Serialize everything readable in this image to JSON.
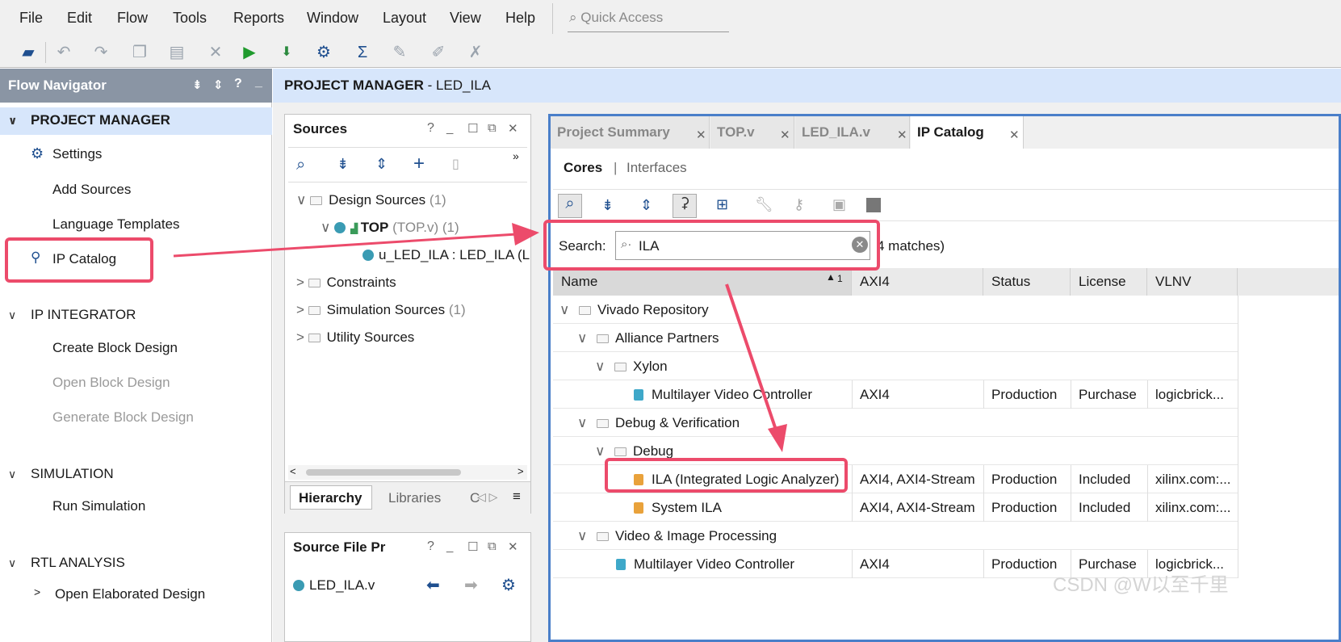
{
  "menu": {
    "file": "File",
    "edit": "Edit",
    "flow": "Flow",
    "tools": "Tools",
    "reports": "Reports",
    "window": "Window",
    "layout": "Layout",
    "view": "View",
    "help": "Help",
    "quick_access": "Quick Access"
  },
  "flow_nav": {
    "title": "Flow Navigator",
    "project_manager": "PROJECT MANAGER",
    "settings": "Settings",
    "add_sources": "Add Sources",
    "language_templates": "Language Templates",
    "ip_catalog": "IP Catalog",
    "ip_integrator": "IP INTEGRATOR",
    "create_block_design": "Create Block Design",
    "open_block_design": "Open Block Design",
    "generate_block_design": "Generate Block Design",
    "simulation": "SIMULATION",
    "run_simulation": "Run Simulation",
    "rtl_analysis": "RTL ANALYSIS",
    "open_elaborated_design": "Open Elaborated Design"
  },
  "header": {
    "title": "PROJECT MANAGER",
    "project": " - LED_ILA"
  },
  "sources": {
    "title": "Sources",
    "design_sources": "Design Sources",
    "design_sources_count": "(1)",
    "top": "TOP",
    "top_file": "(TOP.v) (1)",
    "u_led_ila": "u_LED_ILA : LED_ILA (L",
    "constraints": "Constraints",
    "simulation_sources": "Simulation Sources",
    "simulation_sources_count": "(1)",
    "utility_sources": "Utility Sources",
    "tab_hierarchy": "Hierarchy",
    "tab_libraries": "Libraries",
    "tab_c": "C"
  },
  "source_file_props": {
    "title": "Source File Pr",
    "file": "LED_ILA.v"
  },
  "tabs": {
    "project_summary": "Project Summary",
    "top_v": "TOP.v",
    "led_ila_v": "LED_ILA.v",
    "ip_catalog": "IP Catalog"
  },
  "ip_catalog": {
    "cores": "Cores",
    "divider": "|",
    "interfaces": "Interfaces",
    "search_label": "Search:",
    "search_value": "ILA",
    "matches": "4 matches)",
    "columns": {
      "name": "Name",
      "sort": "1",
      "axi4": "AXI4",
      "status": "Status",
      "license": "License",
      "vlnv": "VLNV"
    },
    "rows": [
      {
        "name": "Vivado Repository",
        "axi": "",
        "status": "",
        "license": "",
        "vlnv": ""
      },
      {
        "name": "Alliance Partners",
        "axi": "",
        "status": "",
        "license": "",
        "vlnv": ""
      },
      {
        "name": "Xylon",
        "axi": "",
        "status": "",
        "license": "",
        "vlnv": ""
      },
      {
        "name": "Multilayer Video Controller",
        "axi": "AXI4",
        "status": "Production",
        "license": "Purchase",
        "vlnv": "logicbrick..."
      },
      {
        "name": "Debug & Verification",
        "axi": "",
        "status": "",
        "license": "",
        "vlnv": ""
      },
      {
        "name": "Debug",
        "axi": "",
        "status": "",
        "license": "",
        "vlnv": ""
      },
      {
        "name": "ILA (Integrated Logic Analyzer)",
        "axi": "AXI4, AXI4-Stream",
        "status": "Production",
        "license": "Included",
        "vlnv": "xilinx.com:..."
      },
      {
        "name": "System ILA",
        "axi": "AXI4, AXI4-Stream",
        "status": "Production",
        "license": "Included",
        "vlnv": "xilinx.com:..."
      },
      {
        "name": "Video & Image Processing",
        "axi": "",
        "status": "",
        "license": "",
        "vlnv": ""
      },
      {
        "name": "Multilayer Video Controller",
        "axi": "AXI4",
        "status": "Production",
        "license": "Purchase",
        "vlnv": "logicbrick..."
      }
    ]
  },
  "watermark": "CSDN @W以至千里",
  "colors": {
    "accent_blue": "#4a7fc9",
    "highlight": "#ec4b6b",
    "nav_header": "#8a95a4",
    "pm_header": "#d7e6fb"
  }
}
